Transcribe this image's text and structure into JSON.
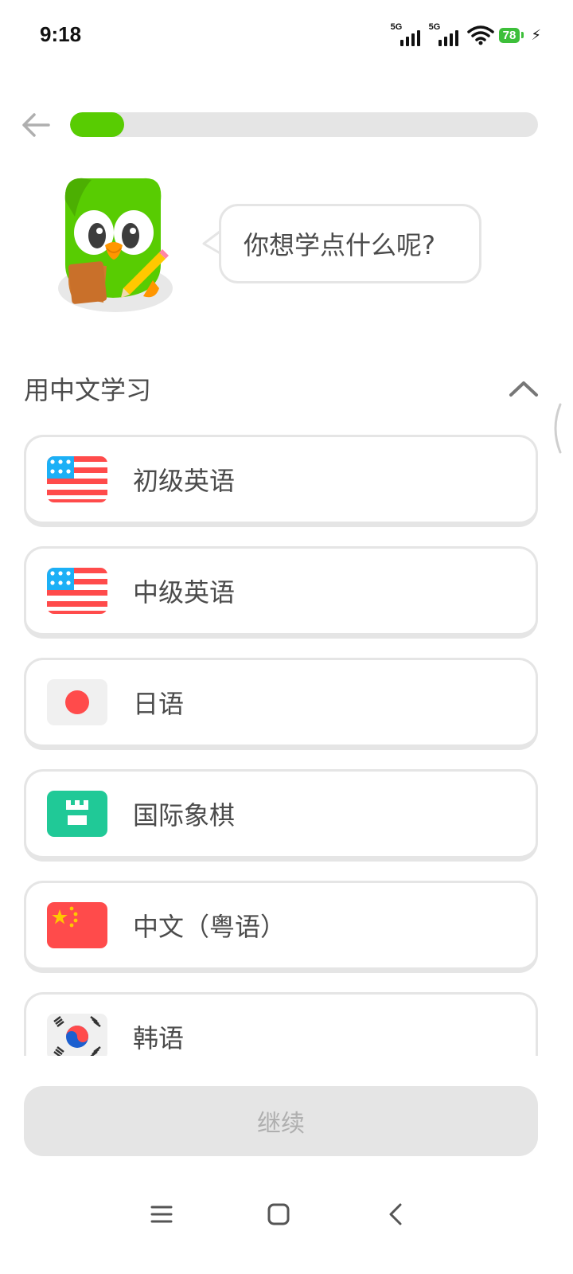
{
  "status_bar": {
    "time": "9:18",
    "signal_1_label": "5G",
    "signal_2_label": "5G",
    "battery_level": "78"
  },
  "header": {
    "progress": 0.115
  },
  "mascot": {
    "speech": "你想学点什么呢?"
  },
  "section": {
    "title": "用中文学习"
  },
  "courses": [
    {
      "label": "初级英语",
      "icon": "us-flag-icon"
    },
    {
      "label": "中级英语",
      "icon": "us-flag-icon"
    },
    {
      "label": "日语",
      "icon": "japan-flag-icon"
    },
    {
      "label": "国际象棋",
      "icon": "chess-rook-icon"
    },
    {
      "label": "中文（粤语）",
      "icon": "china-flag-icon"
    },
    {
      "label": "韩语",
      "icon": "korea-flag-icon"
    }
  ],
  "footer": {
    "continue_label": "继续"
  },
  "colors": {
    "accent": "#58cc02",
    "card_border": "#e5e5e5",
    "text": "#4b4b4b",
    "disabled_text": "#afafaf"
  }
}
